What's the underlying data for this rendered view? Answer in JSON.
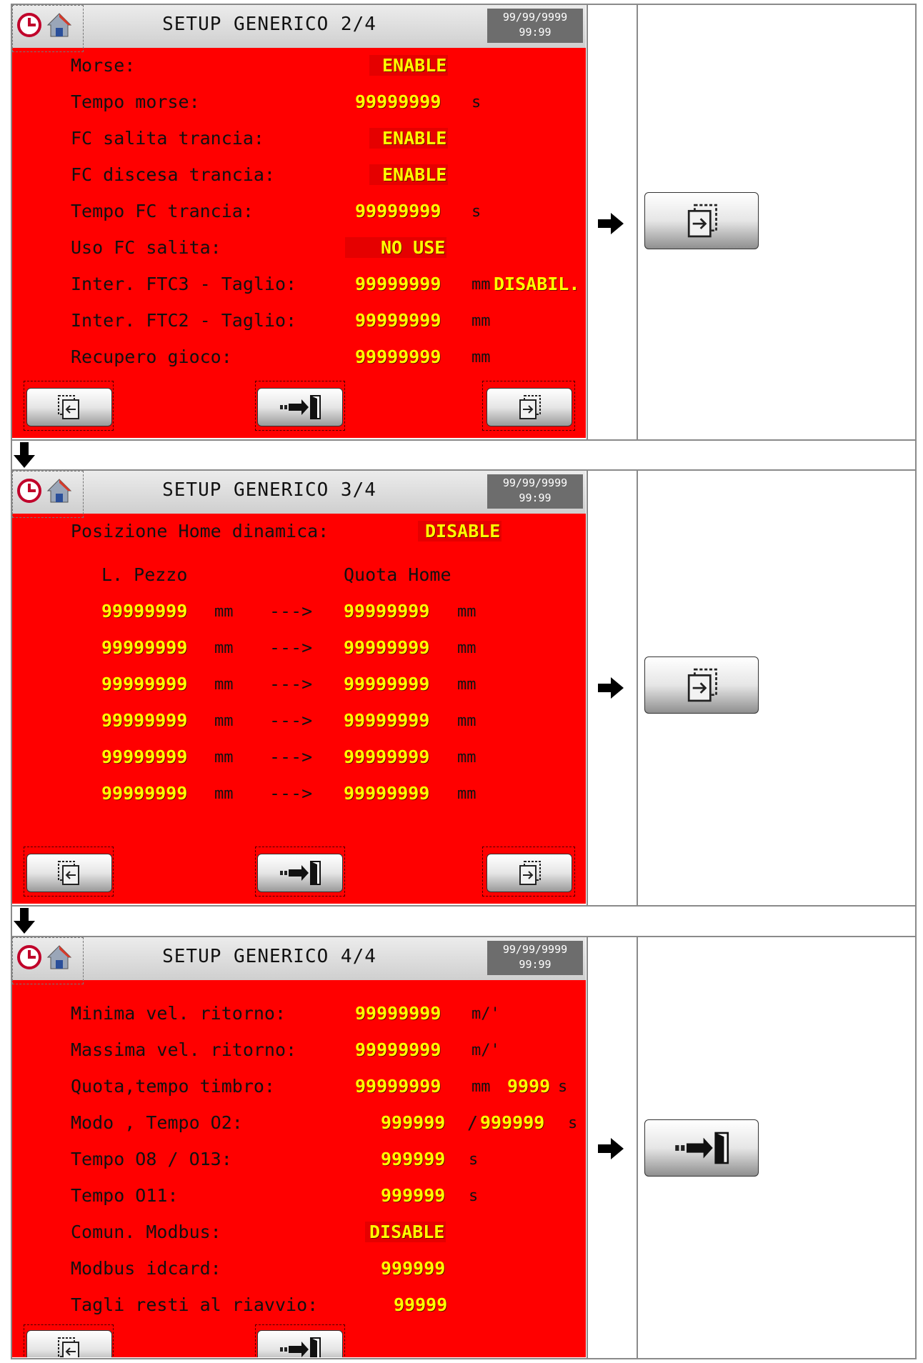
{
  "screens": [
    {
      "title": "SETUP GENERICO 2/4",
      "date": "99/99/9999",
      "time": "99:99",
      "rows": [
        {
          "label": "Morse:",
          "value": "ENABLE"
        },
        {
          "label": "Tempo morse:",
          "value": "99999999",
          "unit": "s"
        },
        {
          "label": "FC salita trancia:",
          "value": "ENABLE"
        },
        {
          "label": "FC discesa trancia:",
          "value": "ENABLE"
        },
        {
          "label": "Tempo FC trancia:",
          "value": "99999999",
          "unit": "s"
        },
        {
          "label": "Uso FC salita:",
          "value": "NO USE"
        },
        {
          "label": "Inter. FTC3 - Taglio:",
          "value": "99999999",
          "unit": "mm",
          "extra": "DISABIL."
        },
        {
          "label": "Inter. FTC2 - Taglio:",
          "value": "99999999",
          "unit": "mm"
        },
        {
          "label": "Recupero gioco:",
          "value": "99999999",
          "unit": "mm"
        }
      ]
    },
    {
      "title": "SETUP GENERICO 3/4",
      "date": "99/99/9999",
      "time": "99:99",
      "dyn_label": "Posizione Home dinamica:",
      "dyn_value": "DISABLE",
      "col_left": "L. Pezzo",
      "col_right": "Quota Home",
      "arrow_text": "--->",
      "pairs": [
        {
          "left": "99999999",
          "left_unit": "mm",
          "right": "99999999",
          "right_unit": "mm"
        },
        {
          "left": "99999999",
          "left_unit": "mm",
          "right": "99999999",
          "right_unit": "mm"
        },
        {
          "left": "99999999",
          "left_unit": "mm",
          "right": "99999999",
          "right_unit": "mm"
        },
        {
          "left": "99999999",
          "left_unit": "mm",
          "right": "99999999",
          "right_unit": "mm"
        },
        {
          "left": "99999999",
          "left_unit": "mm",
          "right": "99999999",
          "right_unit": "mm"
        },
        {
          "left": "99999999",
          "left_unit": "mm",
          "right": "99999999",
          "right_unit": "mm"
        }
      ]
    },
    {
      "title": "SETUP GENERICO 4/4",
      "date": "99/99/9999",
      "time": "99:99",
      "rows": [
        {
          "label": "Minima vel. ritorno:",
          "value": "99999999",
          "unit": "m/'"
        },
        {
          "label": "Massima vel. ritorno:",
          "value": "99999999",
          "unit": "m/'"
        },
        {
          "label": "Quota,tempo timbro:",
          "value": "99999999",
          "unit": "mm",
          "value2": "9999",
          "unit2": "s"
        },
        {
          "label": "Modo , Tempo O2:",
          "value": "999999",
          "sep": "/",
          "value2": "999999",
          "unit2": "s"
        },
        {
          "label": "Tempo O8 / O13:",
          "value": "999999",
          "unit": "s"
        },
        {
          "label": "Tempo O11:",
          "value": "999999",
          "unit": "s"
        },
        {
          "label": "Comun. Modbus:",
          "value": "DISABLE"
        },
        {
          "label": "Modbus idcard:",
          "value": "999999"
        },
        {
          "label": "Tagli resti al riavvio:",
          "value": "99999"
        }
      ]
    }
  ],
  "icons": {
    "clock": "clock-icon",
    "home": "home-icon",
    "prev": "page-prev-icon",
    "next": "page-next-icon",
    "exit": "exit-door-icon"
  },
  "colors": {
    "screen_bg": "#ff0000",
    "value_text": "#ffff00",
    "titlebar": "#dcdcdc",
    "datetime_bg": "#6d6d6d"
  }
}
